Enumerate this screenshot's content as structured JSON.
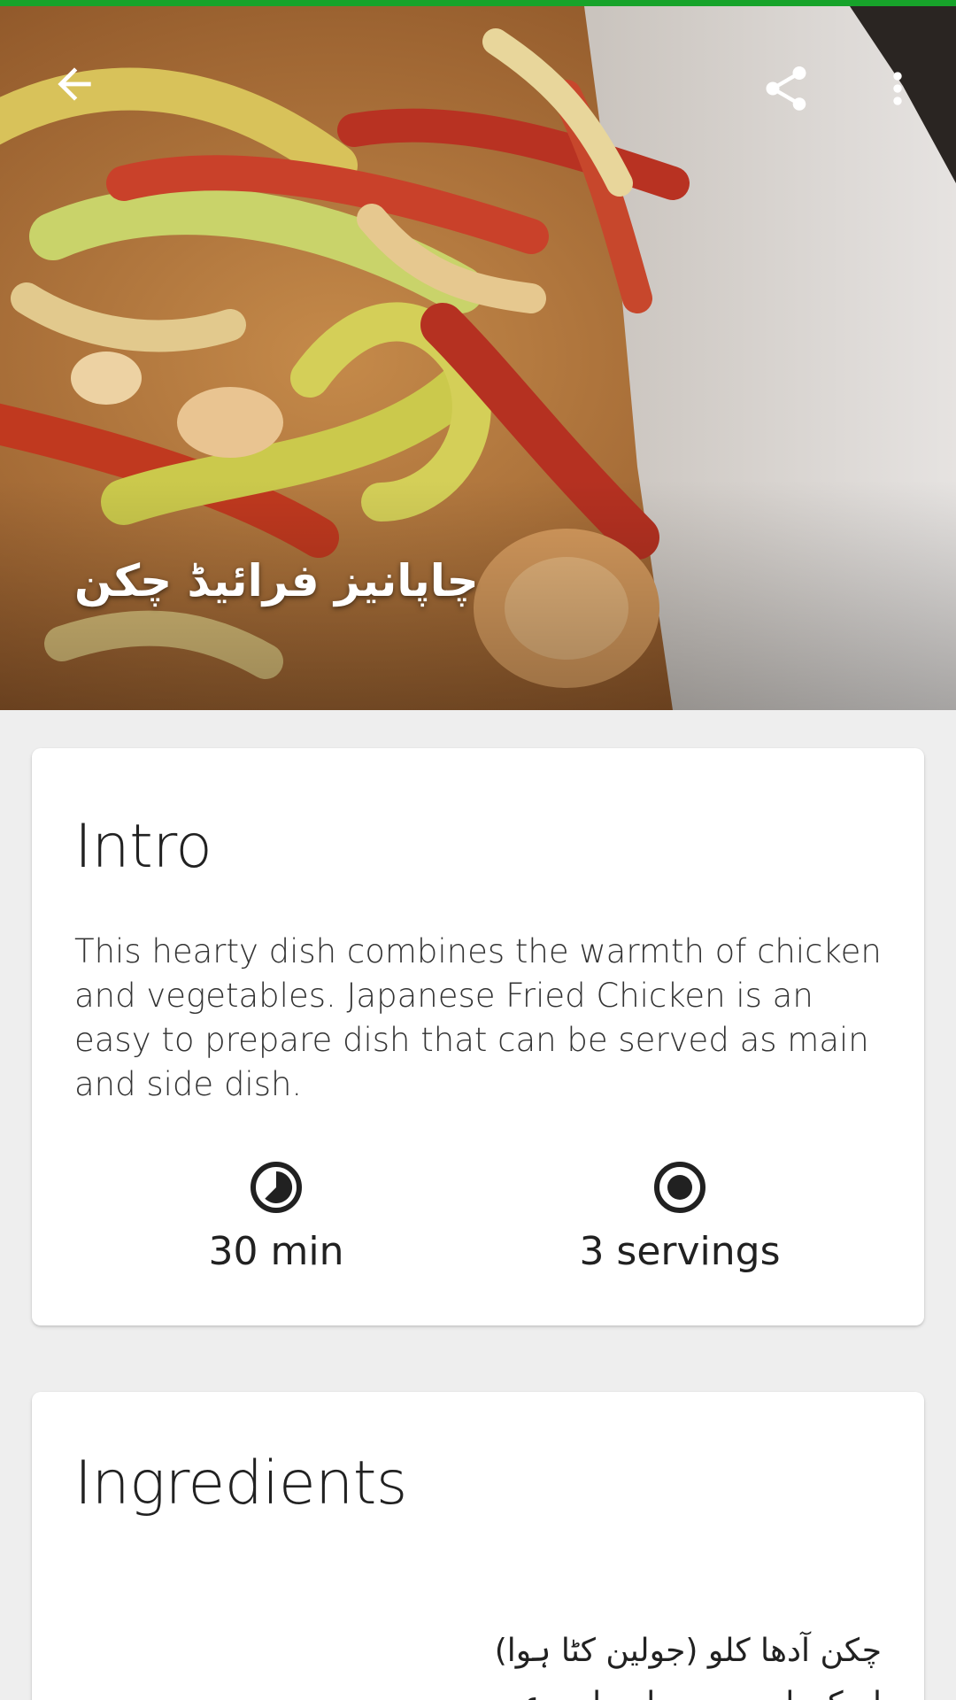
{
  "colors": {
    "accent_bar": "#17a32a",
    "page_background": "#eeeeee",
    "card_background": "#ffffff",
    "text_primary": "#212121"
  },
  "header": {
    "back_icon": "arrow-back-icon",
    "share_icon": "share-icon",
    "more_icon": "more-vertical-icon",
    "recipe_title": "چاپانیز فرائیڈ چکن"
  },
  "intro": {
    "title": "Intro",
    "description": "This hearty dish combines the warmth of chicken and vegetables. Japanese Fried Chicken is an easy to prepare dish that can be served as main and side dish.",
    "time_icon": "timer-icon",
    "time_label": "30 min",
    "servings_icon": "servings-icon",
    "servings_label": "3 servings"
  },
  "ingredients": {
    "title": "Ingredients",
    "items": [
      "چکن آدھا کلو (جولین کٹا ہوا)",
      "ادرک، لہسن پیسا ہوا دو عدد"
    ]
  }
}
